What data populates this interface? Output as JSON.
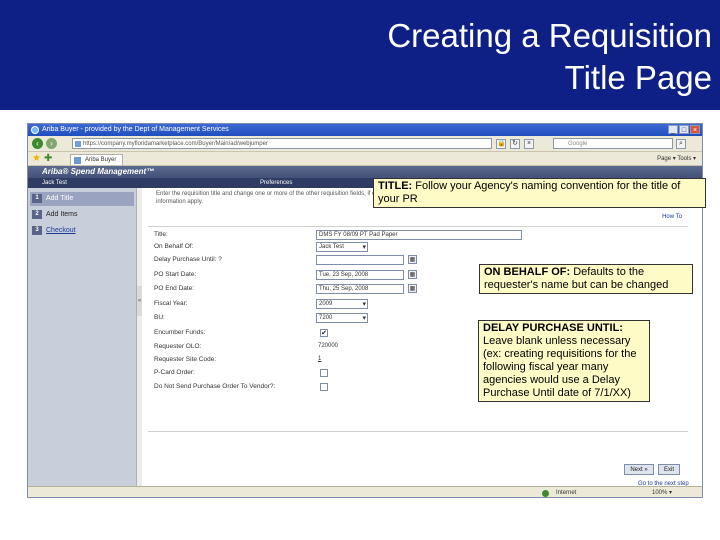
{
  "slide": {
    "title_line1": "Creating a Requisition",
    "title_line2": "Title Page",
    "header_color": "#0e1f86",
    "callout_color": "#fffbc7"
  },
  "browser": {
    "window_title": "Ariba Buyer - provided by the Dept of Management Services",
    "address": "https://company.myfloridamarketplace.com/Buyer/Main/ad/webjumper",
    "search_placeholder": "Google",
    "tab_label": "Ariba Buyer",
    "tools_text": "Page ▾  Tools ▾",
    "status_zone": "Internet",
    "status_zoom": "100% ▾",
    "window_buttons": [
      "_",
      "□",
      "×"
    ]
  },
  "app": {
    "brand": "Ariba® Spend Management™",
    "user": "Jack Test",
    "section": "Preferences",
    "steps": [
      {
        "num": "1",
        "label": "Add Title"
      },
      {
        "num": "2",
        "label": "Add Items"
      },
      {
        "num": "3",
        "label": "Checkout"
      }
    ],
    "intro": "Enter the requisition title and change one or more of the other requisition fields, if desired. If you are creating the requisition on behalf of another user, the user's accounting, shipping, and delivery information apply.",
    "how_to": "How To",
    "fields": [
      {
        "label": "Title:",
        "value": "DMS FY 08/09 PT Pad Paper"
      },
      {
        "label": "On Behalf Of:",
        "value": "Jack Test"
      },
      {
        "label": "Delay Purchase Until: ?",
        "value": ""
      },
      {
        "label": "PO Start Date:",
        "value": "Tue, 23 Sep, 2008"
      },
      {
        "label": "PO End Date:",
        "value": "Thu, 25 Sep, 2008"
      },
      {
        "label": "Fiscal Year:",
        "value": "2009"
      },
      {
        "label": "BU:",
        "value": "7200"
      },
      {
        "label": "Encumber Funds:",
        "value": "✔"
      },
      {
        "label": "Requester OLO:",
        "value": "720000"
      },
      {
        "label": "Requester Site Code:",
        "value": "1"
      },
      {
        "label": "P-Card Order:",
        "value": ""
      },
      {
        "label": "Do Not Send Purchase Order To Vendor?:",
        "value": ""
      }
    ],
    "next_button": "Next »",
    "exit_button": "Exit",
    "goto_link": "Go to the next step"
  },
  "callouts": {
    "title": {
      "heading": "TITLE:",
      "text": "Follow your Agency's naming convention for the title of your PR"
    },
    "on_behalf": {
      "heading": "ON BEHALF OF:",
      "text": "Defaults to the requester's name but can be changed"
    },
    "delay": {
      "heading": "DELAY PURCHASE UNTIL:",
      "text": "Leave blank unless necessary (ex: creating requisitions for the following fiscal year many agencies would use a Delay Purchase Until date of 7/1/XX)"
    }
  }
}
